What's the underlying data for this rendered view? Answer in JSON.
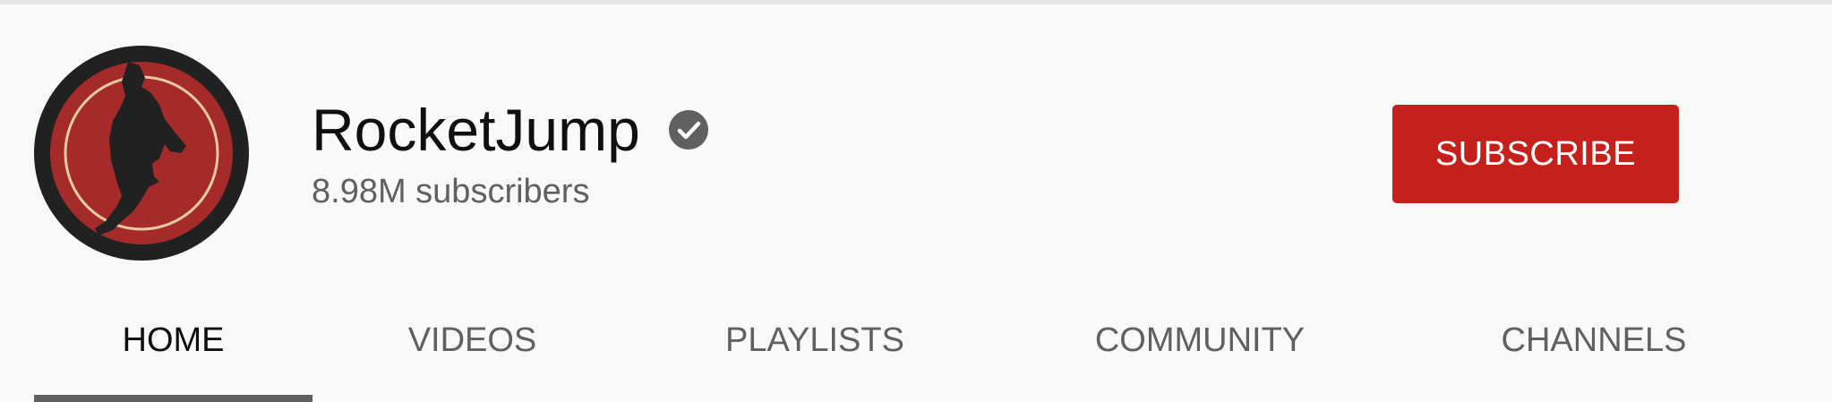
{
  "channel": {
    "name": "RocketJump",
    "verified": true,
    "subscribers": "8.98M subscribers",
    "subscribe_label": "SUBSCRIBE"
  },
  "tabs": [
    {
      "label": "HOME",
      "active": true
    },
    {
      "label": "VIDEOS",
      "active": false
    },
    {
      "label": "PLAYLISTS",
      "active": false
    },
    {
      "label": "COMMUNITY",
      "active": false
    },
    {
      "label": "CHANNELS",
      "active": false
    }
  ],
  "colors": {
    "background": "#f9f9f9",
    "subscribe": "#c4211c",
    "avatar_ring": "#212121",
    "avatar_fill": "#a52a2a",
    "text_primary": "#0f0f0f",
    "text_secondary": "#606060"
  },
  "icons": {
    "verified": "verified-check-icon",
    "avatar": "rocketjump-logo"
  }
}
